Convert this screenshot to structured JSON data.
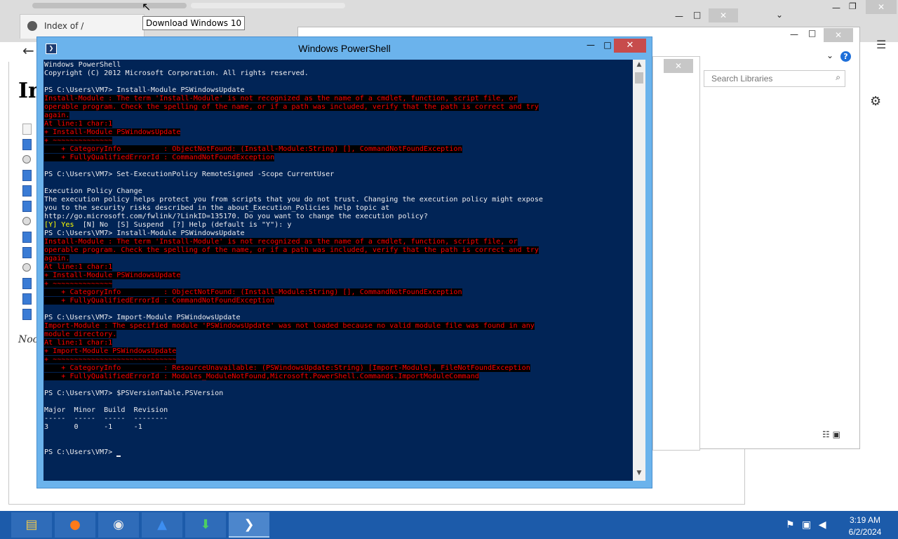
{
  "browser": {
    "tab_title": "Index of /",
    "page_heading": "In",
    "page_italic_text": "Noc",
    "tooltip": "Download Windows 10"
  },
  "libraries": {
    "search_placeholder": "Search Libraries",
    "help_label": "?"
  },
  "powershell": {
    "window_title": "Windows PowerShell",
    "lines": [
      {
        "t": "Windows PowerShell",
        "s": "w"
      },
      {
        "t": "Copyright (C) 2012 Microsoft Corporation. All rights reserved.",
        "s": "w"
      },
      {
        "t": "",
        "s": "w"
      },
      {
        "t": "PS C:\\Users\\VM7> Install-Module PSWindowsUpdate",
        "s": "w"
      },
      {
        "t": "Install-Module : The term 'Install-Module' is not recognized as the name of a cmdlet, function, script file, or",
        "s": "e"
      },
      {
        "t": "operable program. Check the spelling of the name, or if a path was included, verify that the path is correct and try",
        "s": "e"
      },
      {
        "t": "again.",
        "s": "e"
      },
      {
        "t": "At line:1 char:1",
        "s": "e"
      },
      {
        "t": "+ Install-Module PSWindowsUpdate",
        "s": "e"
      },
      {
        "t": "+ ~~~~~~~~~~~~~~",
        "s": "e"
      },
      {
        "t": "    + CategoryInfo          : ObjectNotFound: (Install-Module:String) [], CommandNotFoundException",
        "s": "e"
      },
      {
        "t": "    + FullyQualifiedErrorId : CommandNotFoundException",
        "s": "e"
      },
      {
        "t": "",
        "s": "w"
      },
      {
        "t": "PS C:\\Users\\VM7> Set-ExecutionPolicy RemoteSigned -Scope CurrentUser",
        "s": "w"
      },
      {
        "t": "",
        "s": "w"
      },
      {
        "t": "Execution Policy Change",
        "s": "w"
      },
      {
        "t": "The execution policy helps protect you from scripts that you do not trust. Changing the execution policy might expose",
        "s": "w"
      },
      {
        "t": "you to the security risks described in the about_Execution_Policies help topic at",
        "s": "w"
      },
      {
        "t": "http://go.microsoft.com/fwlink/?LinkID=135170. Do you want to change the execution policy?",
        "s": "w"
      },
      {
        "t": "[Y] Yes  [N] No  [S] Suspend  [?] Help (default is \"Y\"): y",
        "s": "mix",
        "y": "[Y] Yes",
        "rest": "  [N] No  [S] Suspend  [?] Help (default is \"Y\"): y"
      },
      {
        "t": "PS C:\\Users\\VM7> Install-Module PSWindowsUpdate",
        "s": "w"
      },
      {
        "t": "Install-Module : The term 'Install-Module' is not recognized as the name of a cmdlet, function, script file, or",
        "s": "e"
      },
      {
        "t": "operable program. Check the spelling of the name, or if a path was included, verify that the path is correct and try",
        "s": "e"
      },
      {
        "t": "again.",
        "s": "e"
      },
      {
        "t": "At line:1 char:1",
        "s": "e"
      },
      {
        "t": "+ Install-Module PSWindowsUpdate",
        "s": "e"
      },
      {
        "t": "+ ~~~~~~~~~~~~~~",
        "s": "e"
      },
      {
        "t": "    + CategoryInfo          : ObjectNotFound: (Install-Module:String) [], CommandNotFoundException",
        "s": "e"
      },
      {
        "t": "    + FullyQualifiedErrorId : CommandNotFoundException",
        "s": "e"
      },
      {
        "t": "",
        "s": "w"
      },
      {
        "t": "PS C:\\Users\\VM7> Import-Module PSWindowsUpdate",
        "s": "w"
      },
      {
        "t": "Import-Module : The specified module 'PSWindowsUpdate' was not loaded because no valid module file was found in any",
        "s": "e"
      },
      {
        "t": "module directory.",
        "s": "e"
      },
      {
        "t": "At line:1 char:1",
        "s": "e"
      },
      {
        "t": "+ Import-Module PSWindowsUpdate",
        "s": "e"
      },
      {
        "t": "+ ~~~~~~~~~~~~~~~~~~~~~~~~~~~~~",
        "s": "e"
      },
      {
        "t": "    + CategoryInfo          : ResourceUnavailable: (PSWindowsUpdate:String) [Import-Module], FileNotFoundException",
        "s": "e"
      },
      {
        "t": "    + FullyQualifiedErrorId : Modules_ModuleNotFound,Microsoft.PowerShell.Commands.ImportModuleCommand",
        "s": "e"
      },
      {
        "t": "",
        "s": "w"
      },
      {
        "t": "PS C:\\Users\\VM7> $PSVersionTable.PSVersion",
        "s": "w"
      },
      {
        "t": "",
        "s": "w"
      },
      {
        "t": "Major  Minor  Build  Revision",
        "s": "w"
      },
      {
        "t": "-----  -----  -----  --------",
        "s": "w"
      },
      {
        "t": "3      0      -1     -1",
        "s": "w"
      },
      {
        "t": "",
        "s": "w"
      },
      {
        "t": "",
        "s": "w"
      },
      {
        "t": "PS C:\\Users\\VM7> ",
        "s": "prompt"
      }
    ]
  },
  "taskbar": {
    "apps": [
      {
        "name": "file-explorer",
        "icon": "folder-icon",
        "glyph": "▤",
        "color": "#f2c94c"
      },
      {
        "name": "firefox",
        "icon": "firefox-icon",
        "glyph": "●",
        "color": "#ff7a1a"
      },
      {
        "name": "chrome",
        "icon": "chrome-icon",
        "glyph": "◉",
        "color": "#e8e8e8"
      },
      {
        "name": "app-drop",
        "icon": "drop-icon",
        "glyph": "▲",
        "color": "#3d8ef0"
      },
      {
        "name": "installer",
        "icon": "installer-icon",
        "glyph": "⬇",
        "color": "#4ccf62"
      },
      {
        "name": "powershell",
        "icon": "powershell-icon",
        "glyph": "❯",
        "color": "#ffffff"
      }
    ],
    "active_app": "powershell",
    "time": "3:19 AM",
    "date": "6/2/2024"
  },
  "colors": {
    "console_bg": "#012456",
    "console_text": "#eeedf0",
    "error_text": "#ff0000",
    "error_bg": "#000000",
    "highlight_text": "#ffff00",
    "titlebar": "#6bb3ec",
    "taskbar": "#1c5baa"
  }
}
